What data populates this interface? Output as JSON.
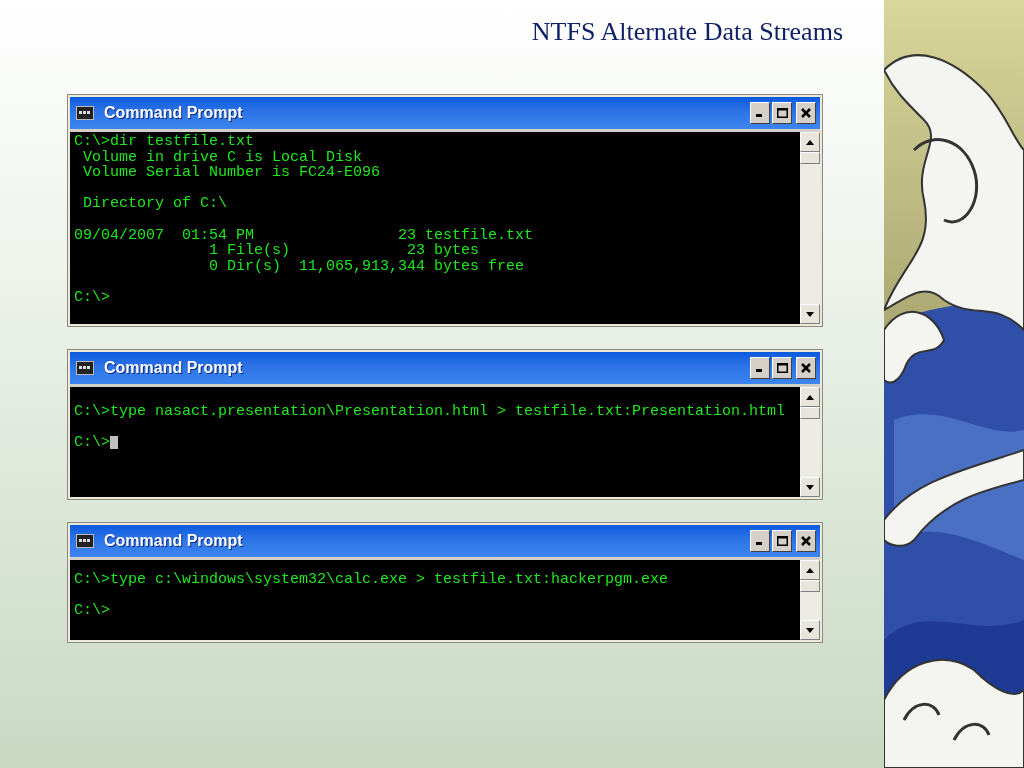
{
  "slide": {
    "title": "NTFS Alternate Data Streams"
  },
  "windows": [
    {
      "title": "Command Prompt",
      "cursor": false,
      "paragraphs": [
        [
          "C:\\>dir testfile.txt",
          " Volume in drive C is Local Disk",
          " Volume Serial Number is FC24-E096"
        ],
        [
          " Directory of C:\\"
        ],
        [
          "09/04/2007  01:54 PM                23 testfile.txt",
          "               1 File(s)             23 bytes",
          "               0 Dir(s)  11,065,913,344 bytes free"
        ],
        [
          "C:\\>"
        ]
      ]
    },
    {
      "title": "Command Prompt",
      "cursor": true,
      "paragraphs": [
        [
          "C:\\>type nasact.presentation\\Presentation.html > testfile.txt:Presentation.html"
        ],
        [
          "C:\\>"
        ]
      ]
    },
    {
      "title": "Command Prompt",
      "cursor": false,
      "paragraphs": [
        [
          "C:\\>type c:\\windows\\system32\\calc.exe > testfile.txt:hackerpgm.exe"
        ],
        [
          "C:\\>"
        ]
      ]
    }
  ]
}
